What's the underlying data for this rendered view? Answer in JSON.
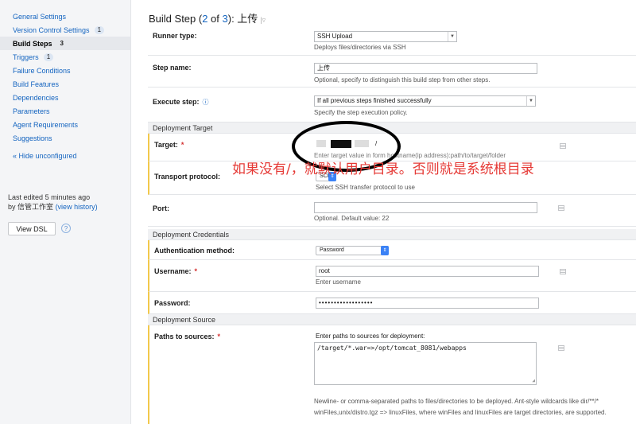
{
  "sidebar": {
    "items": [
      {
        "label": "General Settings",
        "badge": ""
      },
      {
        "label": "Version Control Settings",
        "badge": "1"
      },
      {
        "label": "Build Steps",
        "badge": "3"
      },
      {
        "label": "Triggers",
        "badge": "1"
      },
      {
        "label": "Failure Conditions",
        "badge": ""
      },
      {
        "label": "Build Features",
        "badge": ""
      },
      {
        "label": "Dependencies",
        "badge": ""
      },
      {
        "label": "Parameters",
        "badge": ""
      },
      {
        "label": "Agent Requirements",
        "badge": ""
      },
      {
        "label": "Suggestions",
        "badge": ""
      }
    ],
    "hide_unconfigured": "« Hide unconfigured",
    "last_edited_prefix": "Last edited",
    "last_edited_time": "5 minutes ago",
    "by_prefix": "by",
    "by_user": "信管工作室",
    "view_history": "(view history)",
    "view_dsl": "View DSL",
    "help_icon": "?"
  },
  "main": {
    "title_prefix": "Build Step (",
    "title_num": "2",
    "title_of": " of ",
    "title_total": "3",
    "title_suffix": "): 上传",
    "title_arrow": "|▿",
    "runner_type": {
      "label": "Runner type:",
      "value": "SSH Upload",
      "hint": "Deploys files/directories via SSH"
    },
    "step_name": {
      "label": "Step name:",
      "value": "上传",
      "hint": "Optional, specify to distinguish this build step from other steps."
    },
    "execute_step": {
      "label": "Execute step:",
      "help": "ⓘ",
      "value": "If all previous steps finished successfully",
      "hint": "Specify the step execution policy."
    },
    "section_deployment_target": "Deployment Target",
    "target": {
      "label": "Target:",
      "required": "*",
      "value": "/",
      "hint": "Enter target value in form hostname(ip address):path/to/target/folder"
    },
    "transport": {
      "label": "Transport protocol:",
      "value": "SCP",
      "hint": "Select SSH transfer protocol to use"
    },
    "port": {
      "label": "Port:",
      "value": "",
      "hint": "Optional. Default value: 22"
    },
    "section_credentials": "Deployment Credentials",
    "auth_method": {
      "label": "Authentication method:",
      "value": "Password"
    },
    "username": {
      "label": "Username:",
      "required": "*",
      "value": "root",
      "hint": "Enter username"
    },
    "password": {
      "label": "Password:",
      "value": "••••••••••••••••••"
    },
    "section_source": "Deployment Source",
    "paths": {
      "label": "Paths to sources:",
      "required": "*",
      "hint_top": "Enter paths to sources for deployment:",
      "value": "/target/*.war=>/opt/tomcat_8081/webapps",
      "hint_bottom_1": "Newline- or comma-separated paths to files/directories to be deployed. Ant-style wildcards like dir/**/*",
      "hint_bottom_2": "winFiles,unix/distro.tgz => linuxFiles, where winFiles and linuxFiles are target directories, are supported."
    }
  },
  "annotation": {
    "text": "如果没有/，就默认用户目录。否则就是系统根目录",
    "color": "#e53935"
  }
}
